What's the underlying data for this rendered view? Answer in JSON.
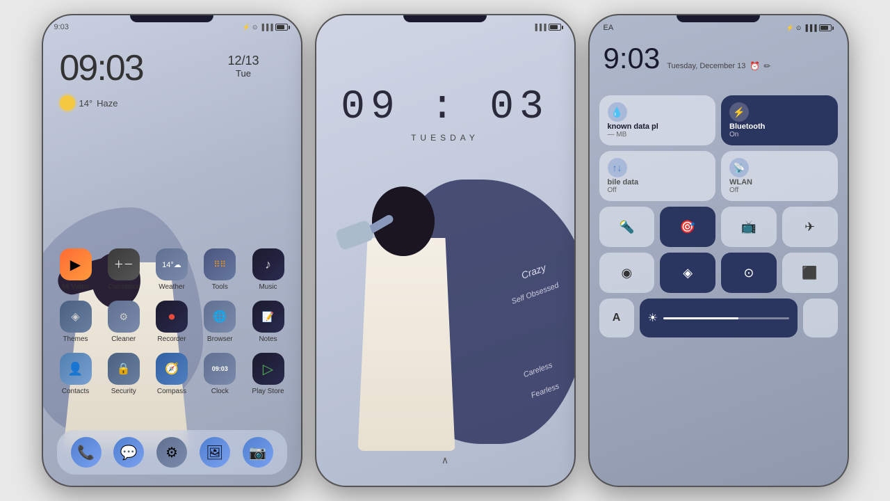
{
  "phone1": {
    "statusBar": {
      "time": "9:03",
      "icons": "bluetooth signal wifi battery"
    },
    "clock": {
      "time": "09:03",
      "date": "12/13",
      "day": "Tue"
    },
    "weather": {
      "temp": "14°",
      "condition": "Haze"
    },
    "apps": [
      [
        {
          "name": "Mi Video",
          "label": "Mi Video",
          "icon": "▶",
          "cls": "ic-mivideo"
        },
        {
          "name": "Calculator",
          "label": "Calculator",
          "icon": "📱",
          "cls": "ic-calc"
        },
        {
          "name": "Weather",
          "label": "Weather",
          "icon": "🌤",
          "cls": "ic-weather"
        },
        {
          "name": "Tools",
          "label": "Tools",
          "icon": "⠿",
          "cls": "ic-tools"
        },
        {
          "name": "Music",
          "label": "Music",
          "icon": "♪",
          "cls": "ic-music"
        }
      ],
      [
        {
          "name": "Themes",
          "label": "Themes",
          "icon": "🎨",
          "cls": "ic-themes"
        },
        {
          "name": "Cleaner",
          "label": "Cleaner",
          "icon": "⚙",
          "cls": "ic-cleaner"
        },
        {
          "name": "Recorder",
          "label": "Recorder",
          "icon": "⏺",
          "cls": "ic-recorder"
        },
        {
          "name": "Browser",
          "label": "Browser",
          "icon": "🌐",
          "cls": "ic-browser"
        },
        {
          "name": "Notes",
          "label": "Notes",
          "icon": "📝",
          "cls": "ic-notes"
        }
      ],
      [
        {
          "name": "Contacts",
          "label": "Contacts",
          "icon": "👤",
          "cls": "ic-contacts"
        },
        {
          "name": "Security",
          "label": "Security",
          "icon": "🔒",
          "cls": "ic-security"
        },
        {
          "name": "Compass",
          "label": "Compass",
          "icon": "🧭",
          "cls": "ic-compass"
        },
        {
          "name": "Clock",
          "label": "Clock",
          "icon": "09:03",
          "cls": "ic-clock"
        },
        {
          "name": "Play Store",
          "label": "Play Store",
          "icon": "▷",
          "cls": "ic-playstore"
        }
      ]
    ],
    "dock": [
      {
        "name": "phone",
        "icon": "📞",
        "cls": "dock-phone"
      },
      {
        "name": "messages",
        "icon": "💬",
        "cls": "dock-msg"
      },
      {
        "name": "settings",
        "icon": "⚙",
        "cls": "dock-settings"
      },
      {
        "name": "gallery",
        "icon": "🖼",
        "cls": "dock-gallery"
      },
      {
        "name": "camera",
        "icon": "📷",
        "cls": "dock-camera"
      }
    ]
  },
  "phone2": {
    "time": "09 : 03",
    "day": "TUESDAY",
    "words": [
      "Crazy",
      "Self Obsessed",
      "Careless",
      "Fearless"
    ]
  },
  "phone3": {
    "statusBar": {
      "carrier": "EA",
      "time": "9:03",
      "icons": "bluetooth signal battery"
    },
    "clock": {
      "time": "9:03",
      "date": "Tuesday, December 13"
    },
    "tiles": {
      "row1": [
        {
          "id": "water",
          "label": "known data pl",
          "sub": "— MB",
          "icon": "💧",
          "type": "light"
        },
        {
          "id": "bluetooth",
          "label": "Bluetooth",
          "sub": "On",
          "icon": "⚡",
          "type": "dark"
        }
      ],
      "row2": [
        {
          "id": "mobiledata",
          "label": "bile data",
          "sub": "Off",
          "icon": "📶",
          "type": "light"
        },
        {
          "id": "wlan",
          "label": "WLAN",
          "sub": "Off",
          "icon": "📡",
          "type": "light"
        }
      ],
      "row3": [
        {
          "id": "flashlight",
          "icon": "🔦",
          "active": false
        },
        {
          "id": "focus",
          "icon": "🎯",
          "active": true
        },
        {
          "id": "cast",
          "icon": "📺",
          "active": false
        },
        {
          "id": "airplane",
          "icon": "✈",
          "active": false
        }
      ],
      "row4": [
        {
          "id": "privacy",
          "icon": "◉",
          "active": false
        },
        {
          "id": "location",
          "icon": "◈",
          "active": true
        },
        {
          "id": "autorotate",
          "icon": "⊙",
          "active": true
        },
        {
          "id": "video",
          "icon": "⬛",
          "active": false
        }
      ]
    },
    "brightness": {
      "aLabel": "A",
      "sunIcon": "☀",
      "level": 60
    }
  }
}
